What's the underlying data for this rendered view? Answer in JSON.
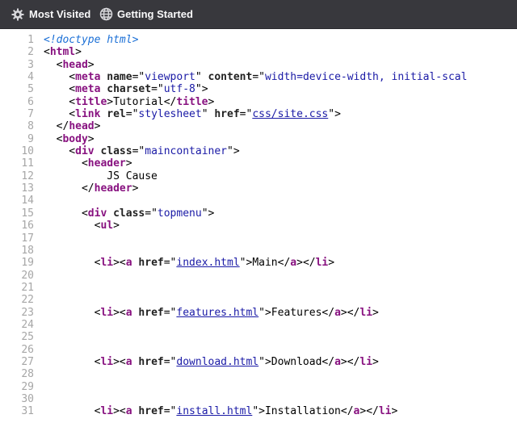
{
  "toolbar": {
    "bookmarks": [
      {
        "label": "Most Visited",
        "icon": "gear-icon"
      },
      {
        "label": "Getting Started",
        "icon": "globe-icon"
      }
    ]
  },
  "source": {
    "lines": [
      [
        [
          "cm",
          "<!doctype html>"
        ]
      ],
      [
        [
          "p",
          "<"
        ],
        [
          "tg",
          "html"
        ],
        [
          "p",
          ">"
        ]
      ],
      [
        [
          "p",
          "  <"
        ],
        [
          "tg",
          "head"
        ],
        [
          "p",
          ">"
        ]
      ],
      [
        [
          "p",
          "    <"
        ],
        [
          "tg",
          "meta"
        ],
        [
          "p",
          " "
        ],
        [
          "at",
          "name"
        ],
        [
          "p",
          "=\""
        ],
        [
          "av",
          "viewport"
        ],
        [
          "p",
          "\" "
        ],
        [
          "at",
          "content"
        ],
        [
          "p",
          "=\""
        ],
        [
          "av",
          "width=device-width, initial-scal"
        ]
      ],
      [
        [
          "p",
          "    <"
        ],
        [
          "tg",
          "meta"
        ],
        [
          "p",
          " "
        ],
        [
          "at",
          "charset"
        ],
        [
          "p",
          "=\""
        ],
        [
          "av",
          "utf-8"
        ],
        [
          "p",
          "\">"
        ]
      ],
      [
        [
          "p",
          "    <"
        ],
        [
          "tg",
          "title"
        ],
        [
          "p",
          ">Tutorial</"
        ],
        [
          "tg",
          "title"
        ],
        [
          "p",
          ">"
        ]
      ],
      [
        [
          "p",
          "    <"
        ],
        [
          "tg",
          "link"
        ],
        [
          "p",
          " "
        ],
        [
          "at",
          "rel"
        ],
        [
          "p",
          "=\""
        ],
        [
          "av",
          "stylesheet"
        ],
        [
          "p",
          "\" "
        ],
        [
          "at",
          "href"
        ],
        [
          "p",
          "=\""
        ],
        [
          "lk",
          "css/site.css"
        ],
        [
          "p",
          "\">"
        ]
      ],
      [
        [
          "p",
          "  </"
        ],
        [
          "tg",
          "head"
        ],
        [
          "p",
          ">"
        ]
      ],
      [
        [
          "p",
          "  <"
        ],
        [
          "tg",
          "body"
        ],
        [
          "p",
          ">"
        ]
      ],
      [
        [
          "p",
          "    <"
        ],
        [
          "tg",
          "div"
        ],
        [
          "p",
          " "
        ],
        [
          "at",
          "class"
        ],
        [
          "p",
          "=\""
        ],
        [
          "av",
          "maincontainer"
        ],
        [
          "p",
          "\">"
        ]
      ],
      [
        [
          "p",
          "      <"
        ],
        [
          "tg",
          "header"
        ],
        [
          "p",
          ">"
        ]
      ],
      [
        [
          "p",
          "          JS Cause"
        ]
      ],
      [
        [
          "p",
          "      </"
        ],
        [
          "tg",
          "header"
        ],
        [
          "p",
          ">"
        ]
      ],
      [],
      [
        [
          "p",
          "      <"
        ],
        [
          "tg",
          "div"
        ],
        [
          "p",
          " "
        ],
        [
          "at",
          "class"
        ],
        [
          "p",
          "=\""
        ],
        [
          "av",
          "topmenu"
        ],
        [
          "p",
          "\">"
        ]
      ],
      [
        [
          "p",
          "        <"
        ],
        [
          "tg",
          "ul"
        ],
        [
          "p",
          ">"
        ]
      ],
      [],
      [],
      [
        [
          "p",
          "        <"
        ],
        [
          "tg",
          "li"
        ],
        [
          "p",
          "><"
        ],
        [
          "tg",
          "a"
        ],
        [
          "p",
          " "
        ],
        [
          "at",
          "href"
        ],
        [
          "p",
          "=\""
        ],
        [
          "lk",
          "index.html"
        ],
        [
          "p",
          "\">Main</"
        ],
        [
          "tg",
          "a"
        ],
        [
          "p",
          "></"
        ],
        [
          "tg",
          "li"
        ],
        [
          "p",
          ">"
        ]
      ],
      [],
      [],
      [],
      [
        [
          "p",
          "        <"
        ],
        [
          "tg",
          "li"
        ],
        [
          "p",
          "><"
        ],
        [
          "tg",
          "a"
        ],
        [
          "p",
          " "
        ],
        [
          "at",
          "href"
        ],
        [
          "p",
          "=\""
        ],
        [
          "lk",
          "features.html"
        ],
        [
          "p",
          "\">Features</"
        ],
        [
          "tg",
          "a"
        ],
        [
          "p",
          "></"
        ],
        [
          "tg",
          "li"
        ],
        [
          "p",
          ">"
        ]
      ],
      [],
      [],
      [],
      [
        [
          "p",
          "        <"
        ],
        [
          "tg",
          "li"
        ],
        [
          "p",
          "><"
        ],
        [
          "tg",
          "a"
        ],
        [
          "p",
          " "
        ],
        [
          "at",
          "href"
        ],
        [
          "p",
          "=\""
        ],
        [
          "lk",
          "download.html"
        ],
        [
          "p",
          "\">Download</"
        ],
        [
          "tg",
          "a"
        ],
        [
          "p",
          "></"
        ],
        [
          "tg",
          "li"
        ],
        [
          "p",
          ">"
        ]
      ],
      [],
      [],
      [],
      [
        [
          "p",
          "        <"
        ],
        [
          "tg",
          "li"
        ],
        [
          "p",
          "><"
        ],
        [
          "tg",
          "a"
        ],
        [
          "p",
          " "
        ],
        [
          "at",
          "href"
        ],
        [
          "p",
          "=\""
        ],
        [
          "lk",
          "install.html"
        ],
        [
          "p",
          "\">Installation</"
        ],
        [
          "tg",
          "a"
        ],
        [
          "p",
          "></"
        ],
        [
          "tg",
          "li"
        ],
        [
          "p",
          ">"
        ]
      ]
    ]
  }
}
